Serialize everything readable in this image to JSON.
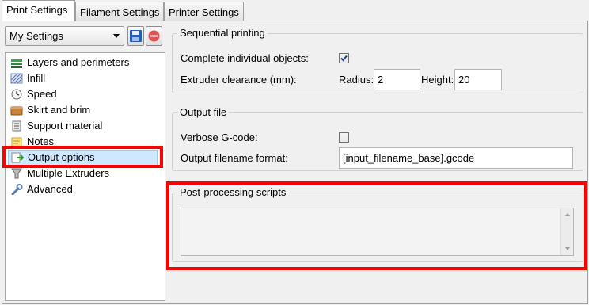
{
  "tabs": [
    {
      "label": "Print Settings",
      "active": true
    },
    {
      "label": "Filament Settings",
      "active": false
    },
    {
      "label": "Printer Settings",
      "active": false
    }
  ],
  "preset": {
    "selected": "My Settings"
  },
  "toolbar": {
    "save_icon": "save-icon",
    "delete_icon": "delete-icon"
  },
  "sidebar": {
    "items": [
      {
        "label": "Layers and perimeters",
        "icon": "layers-icon"
      },
      {
        "label": "Infill",
        "icon": "infill-icon"
      },
      {
        "label": "Speed",
        "icon": "speed-icon"
      },
      {
        "label": "Skirt and brim",
        "icon": "skirt-brim-icon"
      },
      {
        "label": "Support material",
        "icon": "support-material-icon"
      },
      {
        "label": "Notes",
        "icon": "notes-icon"
      },
      {
        "label": "Output options",
        "icon": "output-options-icon",
        "selected": true
      },
      {
        "label": "Multiple Extruders",
        "icon": "extruders-icon"
      },
      {
        "label": "Advanced",
        "icon": "wrench-icon"
      }
    ]
  },
  "sequential": {
    "title": "Sequential printing",
    "complete_label": "Complete individual objects:",
    "complete_checked": true,
    "clearance_label": "Extruder clearance (mm):",
    "radius_label": "Radius:",
    "radius_value": "2",
    "height_label": "Height:",
    "height_value": "20"
  },
  "output_file": {
    "title": "Output file",
    "verbose_label": "Verbose G-code:",
    "verbose_checked": false,
    "filename_label": "Output filename format:",
    "filename_value": "[input_filename_base].gcode"
  },
  "post_processing": {
    "title": "Post-processing scripts",
    "value": ""
  },
  "colors": {
    "highlight": "#ff0000",
    "selection": "#cde8ff"
  }
}
